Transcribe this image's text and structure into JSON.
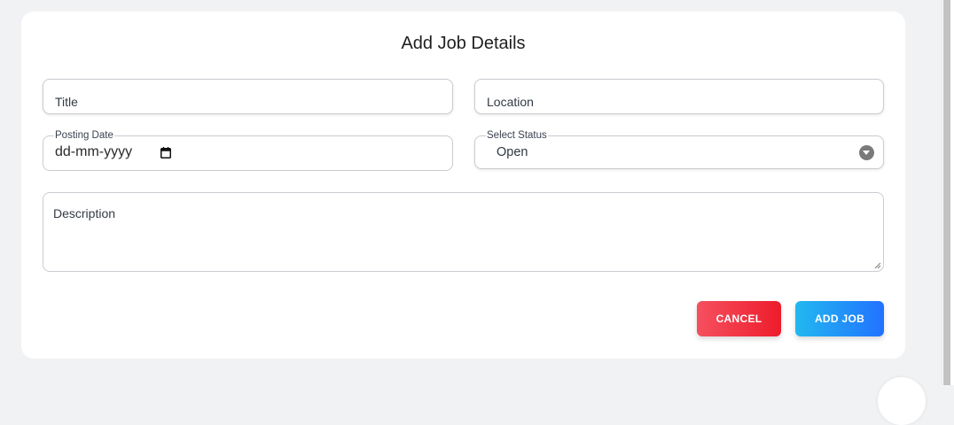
{
  "form": {
    "title": "Add Job Details",
    "title_field": {
      "placeholder": "Title"
    },
    "location_field": {
      "placeholder": "Location"
    },
    "posting_date": {
      "label": "Posting Date",
      "value": "dd-mm-yyyy",
      "icon": "calendar-icon"
    },
    "status": {
      "label": "Select Status",
      "selected": "Open",
      "icon": "dropdown-arrow-icon"
    },
    "description": {
      "placeholder": "Description"
    }
  },
  "actions": {
    "cancel_label": "CANCEL",
    "add_label": "ADD JOB"
  },
  "colors": {
    "cancel_gradient": [
      "#f5505f",
      "#ee1c2b"
    ],
    "add_gradient": [
      "#22b8f0",
      "#2272ff"
    ],
    "page_background": "#f1f2f4",
    "card_background": "#ffffff"
  }
}
